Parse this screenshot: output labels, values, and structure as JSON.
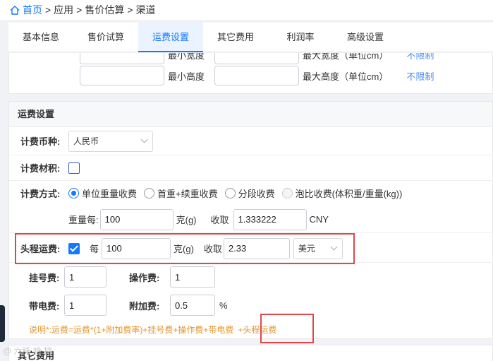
{
  "breadcrumb": {
    "home": "首页",
    "items": [
      "应用",
      "售价估算",
      "渠道"
    ],
    "separator": ">"
  },
  "tabs": [
    {
      "label": "基本信息",
      "active": false
    },
    {
      "label": "售价试算",
      "active": false
    },
    {
      "label": "运费设置",
      "active": true
    },
    {
      "label": "其它费用",
      "active": false
    },
    {
      "label": "利润率",
      "active": false
    },
    {
      "label": "高级设置",
      "active": false
    }
  ],
  "dimensions": {
    "row1": {
      "min_label": "最小宽度",
      "max_label": "最大宽度（单位cm）",
      "link": "不限制"
    },
    "row2": {
      "min_label": "最小高度",
      "max_label": "最大高度（单位cm）",
      "link": "不限制"
    }
  },
  "shipping": {
    "title": "运费设置",
    "currency_label": "计费币种:",
    "currency_value": "人民币",
    "material_label": "计费材积:",
    "material_checked": false,
    "method_label": "计费方式:",
    "methods": [
      {
        "label": "单位重量收费",
        "checked": true,
        "disabled": false
      },
      {
        "label": "首重+续重收费",
        "checked": false,
        "disabled": false
      },
      {
        "label": "分段收费",
        "checked": false,
        "disabled": false
      },
      {
        "label": "泡比收费(体积重/重量(kg))",
        "checked": false,
        "disabled": true
      }
    ],
    "weight_label": "重量每:",
    "weight_value": "100",
    "weight_unit": "克(g)",
    "charge_label": "收取",
    "charge_value": "1.333222",
    "charge_currency": "CNY",
    "first_leg": {
      "label": "头程运费:",
      "checked": true,
      "per_label": "每",
      "per_value": "100",
      "unit": "克(g)",
      "charge_label": "收取",
      "charge_value": "2.33",
      "currency": "美元"
    },
    "fees": {
      "register_label": "挂号费:",
      "register_value": "1",
      "operation_label": "操作费:",
      "operation_value": "1",
      "battery_label": "带电费:",
      "battery_value": "1",
      "surcharge_label": "附加费:",
      "surcharge_value": "0.5",
      "surcharge_unit": "%"
    },
    "note_main": "说明*:运费=运费*(1+附加费率)+挂号费+操作费+带电费",
    "note_highlight": "+头程运费"
  },
  "next_section": {
    "title": "其它费用"
  },
  "watermark": "@ 六脉 哈 持",
  "colors": {
    "accent": "#1677ff",
    "highlight": "#e0474c",
    "note": "#e6932a"
  }
}
